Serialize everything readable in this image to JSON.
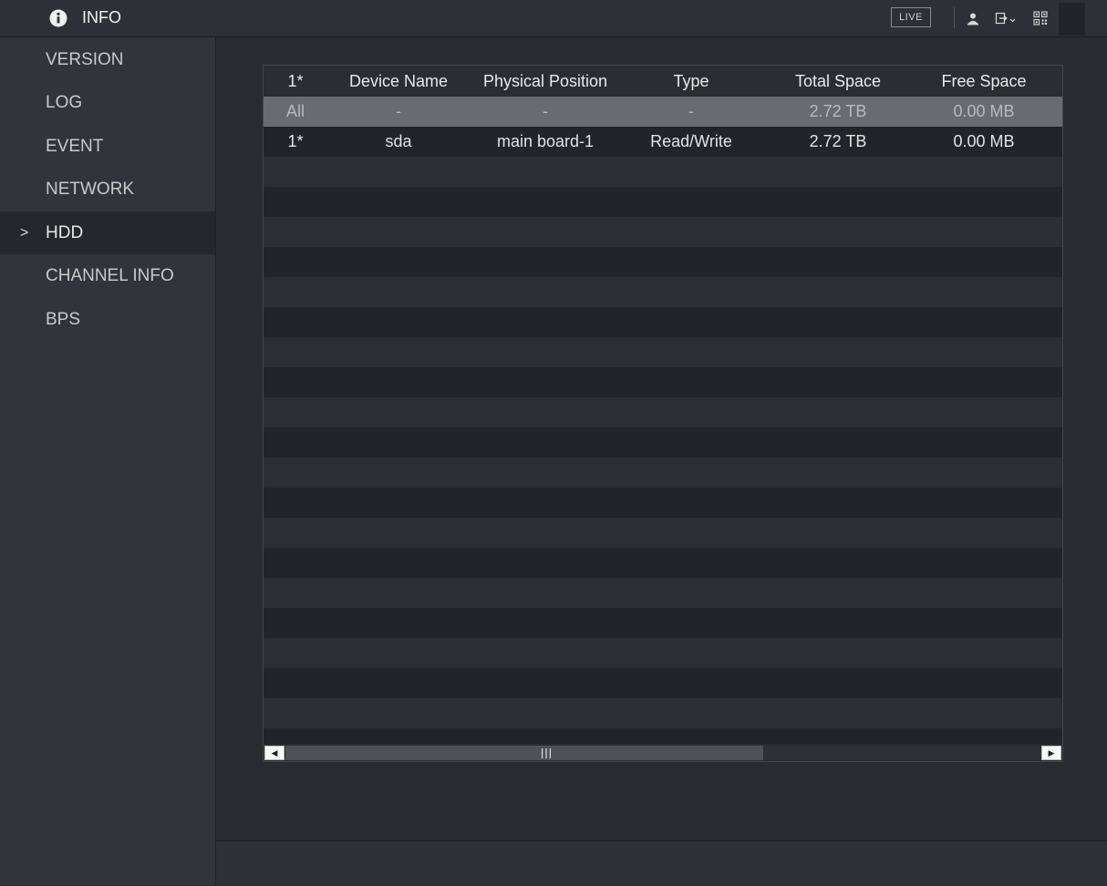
{
  "header": {
    "title": "INFO",
    "live_label": "LIVE",
    "icons": [
      "info-icon",
      "user-icon",
      "logout-icon",
      "qr-code-icon"
    ]
  },
  "sidebar": {
    "items": [
      {
        "label": "VERSION"
      },
      {
        "label": "LOG"
      },
      {
        "label": "EVENT"
      },
      {
        "label": "NETWORK"
      },
      {
        "label": "HDD",
        "active": true,
        "arrow": ">"
      },
      {
        "label": "CHANNEL INFO"
      },
      {
        "label": "BPS"
      }
    ]
  },
  "table": {
    "columns": [
      "1*",
      "Device Name",
      "Physical Position",
      "Type",
      "Total Space",
      "Free Space"
    ],
    "rows": [
      {
        "cells": [
          "All",
          "-",
          "-",
          "-",
          "2.72 TB",
          "0.00 MB"
        ],
        "selected": true
      },
      {
        "cells": [
          "1*",
          "sda",
          "main board-1",
          "Read/Write",
          "2.72 TB",
          "0.00 MB"
        ],
        "selected": false
      }
    ]
  },
  "scrollbar": {
    "left_arrow": "◀",
    "right_arrow": "▶",
    "thumb_fraction": 0.62
  },
  "colors": {
    "background": "#2a2b31",
    "sidebar": "#33343b",
    "active_item": "#26272d",
    "selected_row": "#6a6b71"
  }
}
